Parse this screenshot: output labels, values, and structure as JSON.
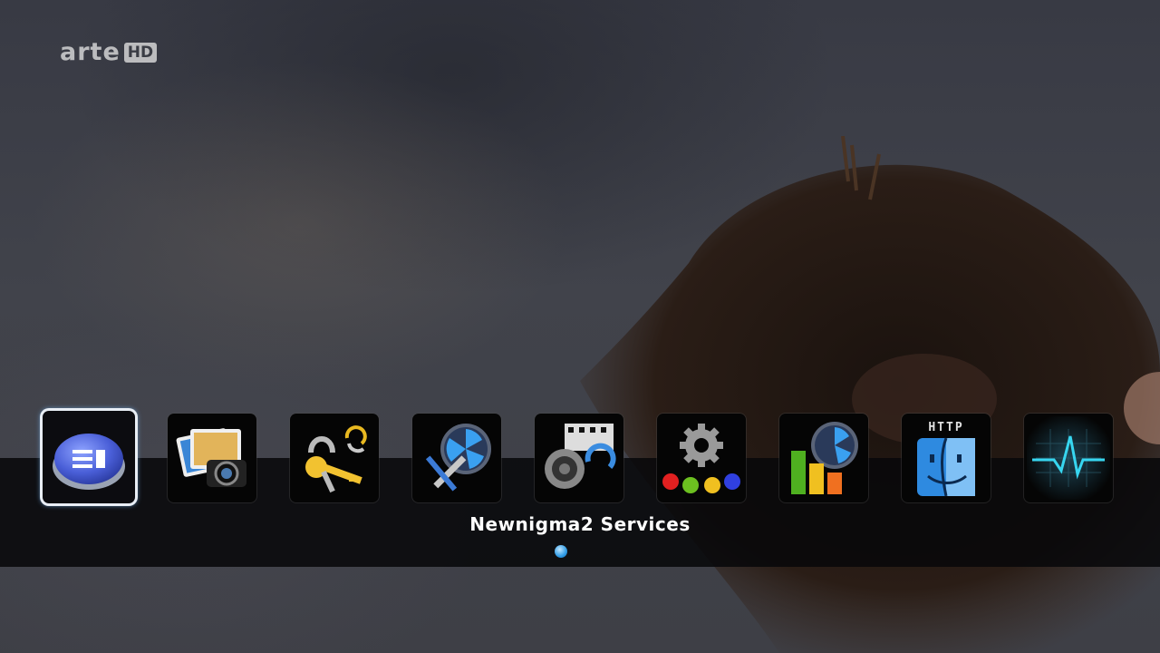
{
  "channel": {
    "name": "arte",
    "badge": "HD"
  },
  "menu": {
    "selected_index": 0,
    "selected_label": "Newnigma2 Services",
    "items": [
      {
        "icon": "newnigma2-services-icon"
      },
      {
        "icon": "picture-player-icon"
      },
      {
        "icon": "softcam-keys-icon"
      },
      {
        "icon": "system-tools-icon"
      },
      {
        "icon": "media-player-icon"
      },
      {
        "icon": "settings-icon"
      },
      {
        "icon": "statistics-icon"
      },
      {
        "icon": "http-finder-icon"
      },
      {
        "icon": "signal-monitor-icon"
      }
    ],
    "http_text": "HTTP",
    "page_indicator_color": "#2f9be5"
  }
}
